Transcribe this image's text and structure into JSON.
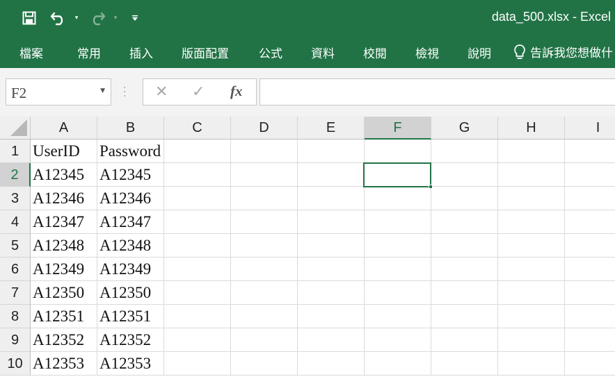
{
  "window": {
    "title": "data_500.xlsx  -  Excel",
    "accent_color": "#217346"
  },
  "quick_access": {
    "save_icon": "save-icon",
    "undo_icon": "undo-icon",
    "redo_icon": "redo-icon",
    "undo_dropdown": "▾",
    "redo_dropdown": "▾",
    "customize": "▾"
  },
  "ribbon": {
    "tabs": [
      {
        "label": "檔案"
      },
      {
        "label": "常用"
      },
      {
        "label": "插入"
      },
      {
        "label": "版面配置"
      },
      {
        "label": "公式"
      },
      {
        "label": "資料"
      },
      {
        "label": "校閱"
      },
      {
        "label": "檢視"
      },
      {
        "label": "說明"
      }
    ],
    "tell_me": "告訴我您想做什"
  },
  "formula_bar": {
    "name_box": "F2",
    "cancel": "✕",
    "enter": "✓",
    "fx": "fx",
    "content": ""
  },
  "sheet": {
    "columns": [
      "A",
      "B",
      "C",
      "D",
      "E",
      "F",
      "G",
      "H",
      "I"
    ],
    "selected_column": "F",
    "rows": [
      "1",
      "2",
      "3",
      "4",
      "5",
      "6",
      "7",
      "8",
      "9",
      "10"
    ],
    "selected_row": "2",
    "active_cell": "F2",
    "data": [
      [
        "UserID",
        "Password"
      ],
      [
        "A12345",
        "A12345"
      ],
      [
        "A12346",
        "A12346"
      ],
      [
        "A12347",
        "A12347"
      ],
      [
        "A12348",
        "A12348"
      ],
      [
        "A12349",
        "A12349"
      ],
      [
        "A12350",
        "A12350"
      ],
      [
        "A12351",
        "A12351"
      ],
      [
        "A12352",
        "A12352"
      ],
      [
        "A12353",
        "A12353"
      ]
    ]
  }
}
